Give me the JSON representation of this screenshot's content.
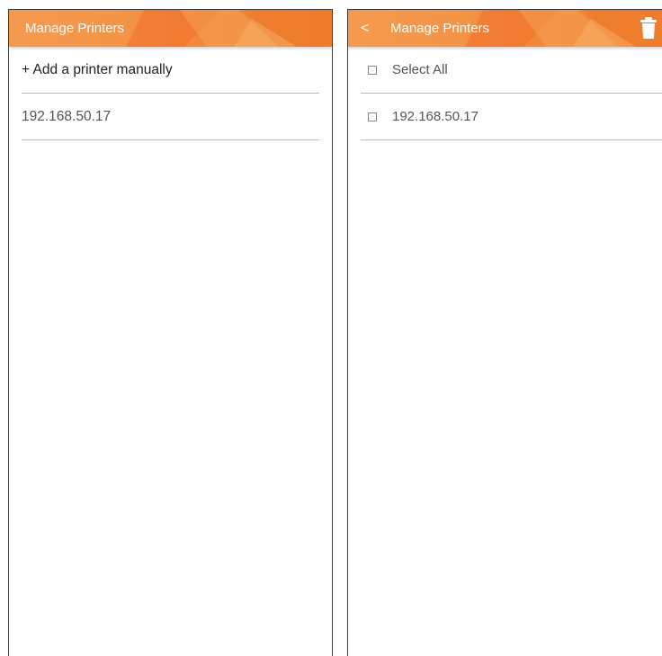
{
  "left_screen": {
    "title": "Manage Printers",
    "items": [
      {
        "label": "+ Add a printer manually"
      },
      {
        "label": "192.168.50.17"
      }
    ]
  },
  "right_screen": {
    "back_glyph": "<",
    "title": "Manage Printers",
    "items": [
      {
        "label": "Select All",
        "checked": false
      },
      {
        "label": "192.168.50.17",
        "checked": false
      }
    ]
  },
  "colors": {
    "accent": "#f08838",
    "accent_light": "#f49a50",
    "divider": "#b9b9b9",
    "text": "#555555"
  },
  "icons": {
    "back": "back-arrow-icon",
    "delete": "trash-icon",
    "checkbox": "checkbox-icon"
  }
}
